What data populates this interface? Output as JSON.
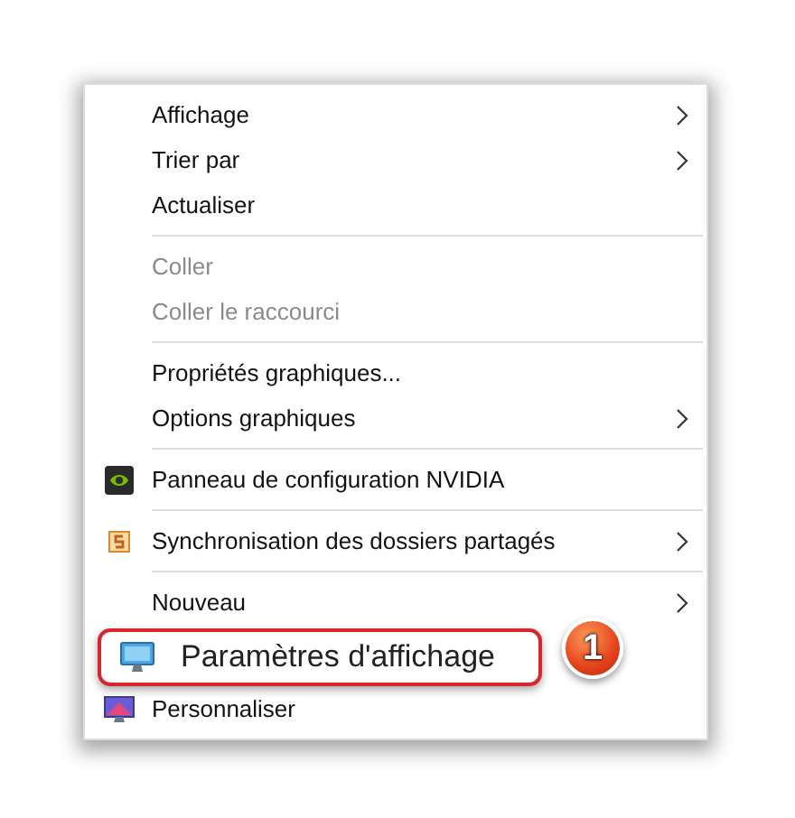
{
  "menu": {
    "items": [
      {
        "kind": "item",
        "label": "Affichage",
        "disabled": false,
        "submenu": true
      },
      {
        "kind": "item",
        "label": "Trier par",
        "disabled": false,
        "submenu": true
      },
      {
        "kind": "item",
        "label": "Actualiser",
        "disabled": false,
        "submenu": false
      },
      {
        "kind": "separator"
      },
      {
        "kind": "item",
        "label": "Coller",
        "disabled": true,
        "submenu": false
      },
      {
        "kind": "item",
        "label": "Coller le raccourci",
        "disabled": true,
        "submenu": false
      },
      {
        "kind": "separator"
      },
      {
        "kind": "item",
        "label": "Propriétés graphiques...",
        "disabled": false,
        "submenu": false
      },
      {
        "kind": "item",
        "label": "Options graphiques",
        "disabled": false,
        "submenu": true
      },
      {
        "kind": "separator"
      },
      {
        "kind": "item",
        "label": "Panneau de configuration NVIDIA",
        "disabled": false,
        "submenu": false
      },
      {
        "kind": "separator"
      },
      {
        "kind": "item",
        "label": "Synchronisation des dossiers partagés",
        "disabled": false,
        "submenu": true
      },
      {
        "kind": "separator"
      },
      {
        "kind": "item",
        "label": "Nouveau",
        "disabled": false,
        "submenu": true
      },
      {
        "kind": "callout",
        "label": "Paramètres d'affichage",
        "badge": "1"
      },
      {
        "kind": "item",
        "label": "Personnaliser",
        "disabled": false,
        "submenu": false
      }
    ]
  }
}
